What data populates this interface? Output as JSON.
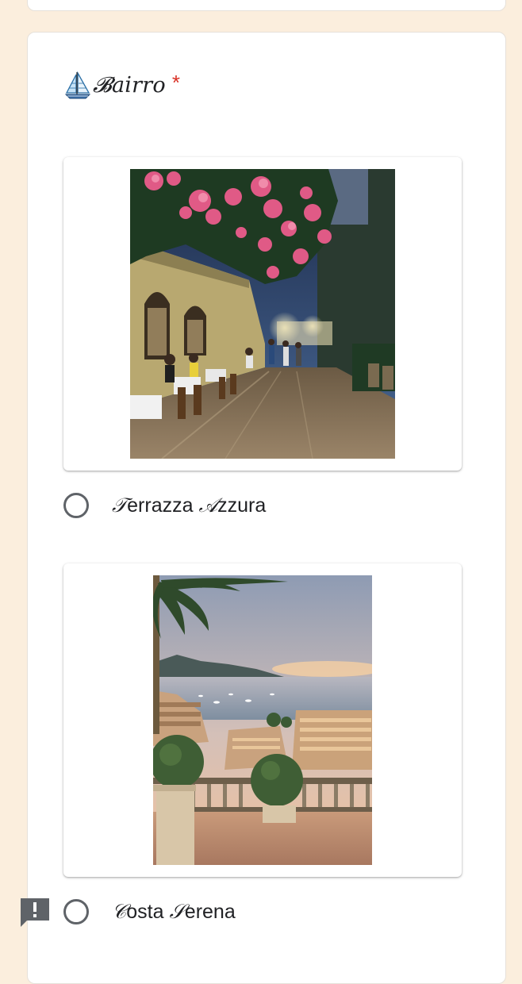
{
  "question": {
    "title": "𝓑airro",
    "required_marker": "*",
    "icon": "sailboat-icon"
  },
  "options": [
    {
      "label_initial": "𝒯",
      "label_rest": "errazza ",
      "label_initial_2": "𝒜",
      "label_rest_2": "zzura",
      "image": "night street cafe with bougainvillea"
    },
    {
      "label_initial": "𝒞",
      "label_rest": "osta ",
      "label_initial_2": "𝒮",
      "label_rest_2": "erena",
      "image": "sunset coastal harbor view with palm tree"
    }
  ],
  "feedback": {
    "icon": "report-icon",
    "glyph": "!"
  },
  "colors": {
    "page_background": "#fbeedd",
    "card_background": "#ffffff",
    "required": "#d93025",
    "radio_border": "#5f6368",
    "text": "#202124",
    "feedback_icon": "#5f6368"
  }
}
